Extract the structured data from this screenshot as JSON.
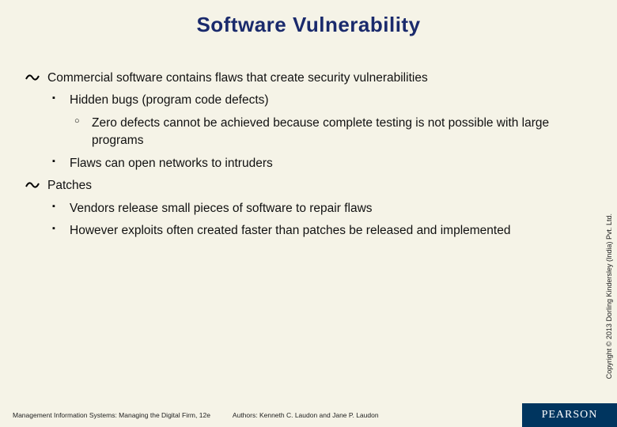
{
  "title": "Software Vulnerability",
  "bullets": {
    "b1": "Commercial software contains flaws that create security vulnerabilities",
    "b1a": "Hidden bugs (program code defects)",
    "b1a1": "Zero defects cannot be achieved because complete testing is not possible with large programs",
    "b1b": "Flaws can open networks to intruders",
    "b2": "Patches",
    "b2a": "Vendors release small pieces of software to repair flaws",
    "b2b": "However exploits often created faster than patches be released and implemented"
  },
  "copyright": "Copyright © 2013 Dorling Kindersley (India) Pvt. Ltd.",
  "footer": {
    "book": "Management Information Systems: Managing the Digital Firm, 12e",
    "authors": "Authors: Kenneth C. Laudon and Jane P. Laudon",
    "publisher": "PEARSON"
  }
}
